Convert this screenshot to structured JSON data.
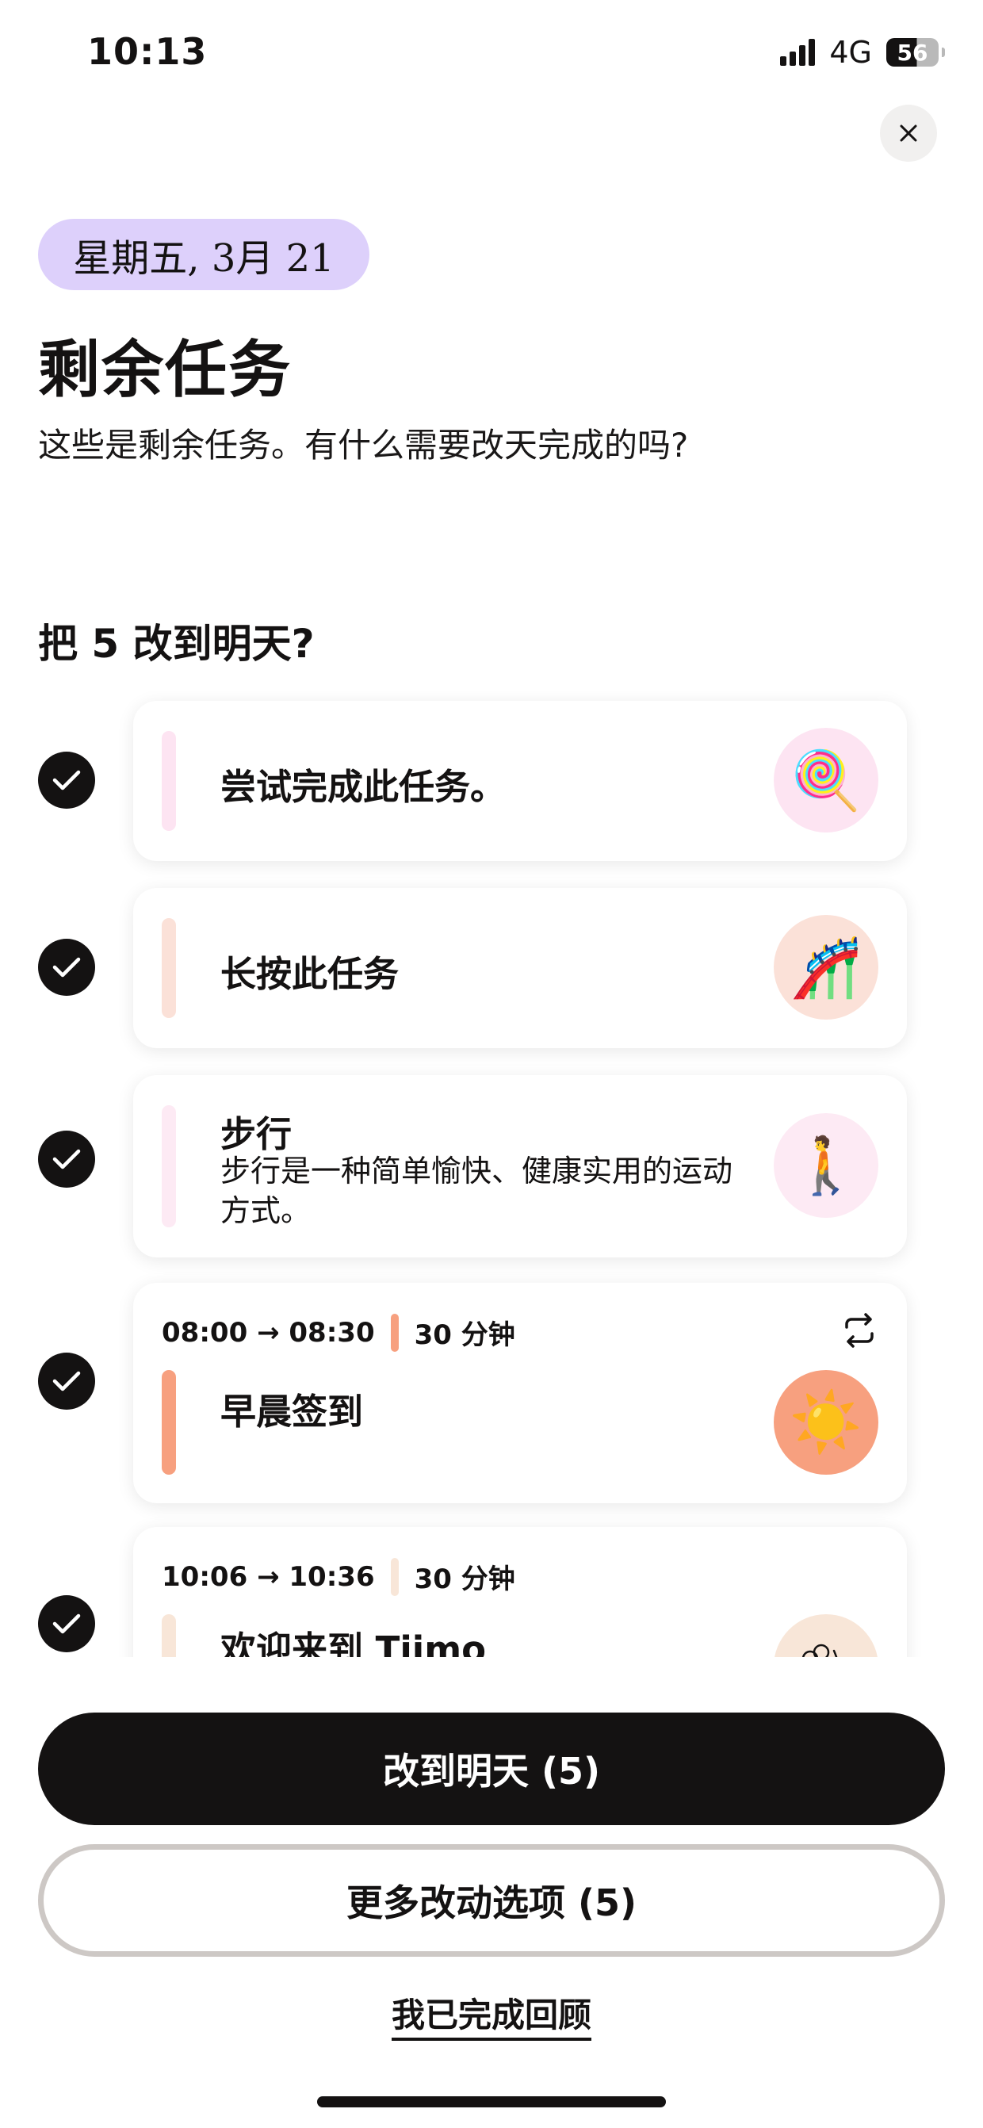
{
  "status_bar": {
    "time": "10:13",
    "network": "4G",
    "battery": "56"
  },
  "header": {
    "date": "星期五, 3月 21",
    "title": "剩余任务",
    "subtitle": "这些是剩余任务。有什么需要改天完成的吗?"
  },
  "section": {
    "heading": "把 5 改到明天?"
  },
  "tasks": [
    {
      "title": "尝试完成此任务。",
      "emoji": "🍭",
      "accent_color": "#fde4f2",
      "emoji_bg": "#fde4f2",
      "checked": true
    },
    {
      "title": "长按此任务",
      "emoji": "🎢",
      "accent_color": "#fbe1d8",
      "emoji_bg": "#fbe1d8",
      "checked": true
    },
    {
      "title": "步行",
      "description": "步行是一种简单愉快、健康实用的运动方式。",
      "emoji": "🚶",
      "accent_color": "#fdeaf4",
      "emoji_bg": "#fdeaf4",
      "checked": true
    },
    {
      "time": "08:00 → 08:30",
      "duration": "30 分钟",
      "title": "早晨签到",
      "emoji": "☀️",
      "accent_color": "#f7a07f",
      "emoji_bg": "#f7a07f",
      "repeat": true,
      "checked": true
    },
    {
      "time": "10:06 → 10:36",
      "duration": "30 分钟",
      "title": "欢迎来到 Tiimo",
      "accent_color": "#f8e6d8",
      "emoji_bg": "#f8e6d8",
      "checked": true
    }
  ],
  "actions": {
    "move_tomorrow": "改到明天 (5)",
    "more_options": "更多改动选项 (5)",
    "done_review": "我已完成回顾"
  },
  "colors": {
    "date_pill": "#ddd0fb",
    "primary_button": "#141212",
    "secondary_border": "#cdc8c5"
  }
}
